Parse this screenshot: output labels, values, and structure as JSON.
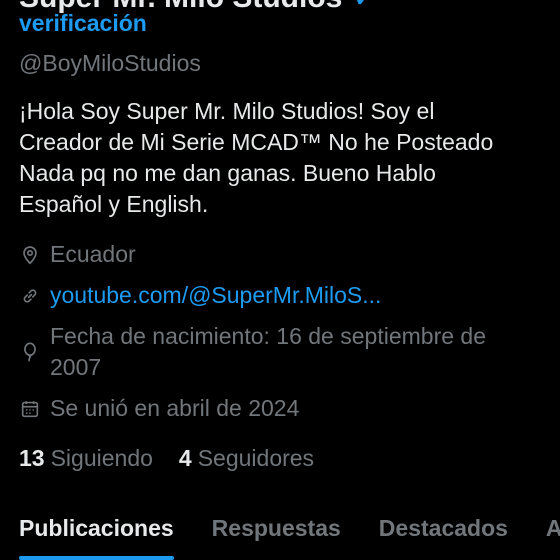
{
  "profile": {
    "display_name": "Super Mr. Milo Studios",
    "verification_label": "verificación",
    "handle": "@BoyMiloStudios",
    "bio_lines": [
      "¡Hola Soy Super Mr. Milo Studios!  Soy el",
      "Creador de Mi Serie MCAD™ No he Posteado",
      "Nada pq no me dan ganas.  Bueno Hablo",
      "Español y English."
    ],
    "location": "Ecuador",
    "website": "youtube.com/@SuperMr.MiloS...",
    "birthday": "Fecha de nacimiento: 16 de septiembre de 2007",
    "joined": "Se unió en abril de 2024",
    "icons": {
      "location": "map-pin-icon",
      "website": "link-icon",
      "birthday": "balloon-icon",
      "joined": "calendar-icon"
    }
  },
  "stats": {
    "following_count": "13",
    "following_label": "Siguiendo",
    "followers_count": "4",
    "followers_label": "Seguidores"
  },
  "tabs": [
    {
      "label": "Publicaciones",
      "active": true
    },
    {
      "label": "Respuestas",
      "active": false
    },
    {
      "label": "Destacados",
      "active": false
    },
    {
      "label": "A",
      "active": false
    }
  ],
  "colors": {
    "background": "#000000",
    "primary_text": "#e7e9ea",
    "secondary_text": "#71767b",
    "accent": "#1d9bf0"
  }
}
